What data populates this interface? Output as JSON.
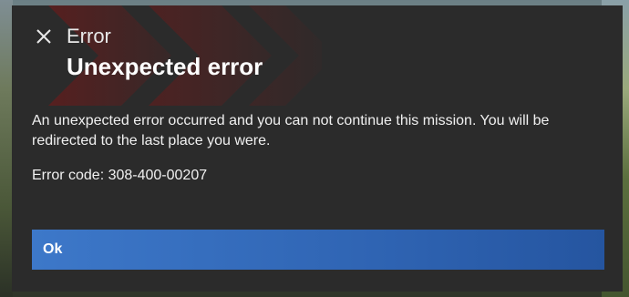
{
  "dialog": {
    "header_label": "Error",
    "title": "Unexpected error",
    "message": "An unexpected error occurred and you can not continue this mission. You will be redirected to the last place you were.",
    "error_code": "Error code: 308-400-00207",
    "ok_label": "Ok",
    "close_icon": "close-icon"
  },
  "colors": {
    "dialog_background": "#2b2b2b",
    "button_blue": "#3d78c9",
    "accent_red": "#8b1c1c"
  }
}
